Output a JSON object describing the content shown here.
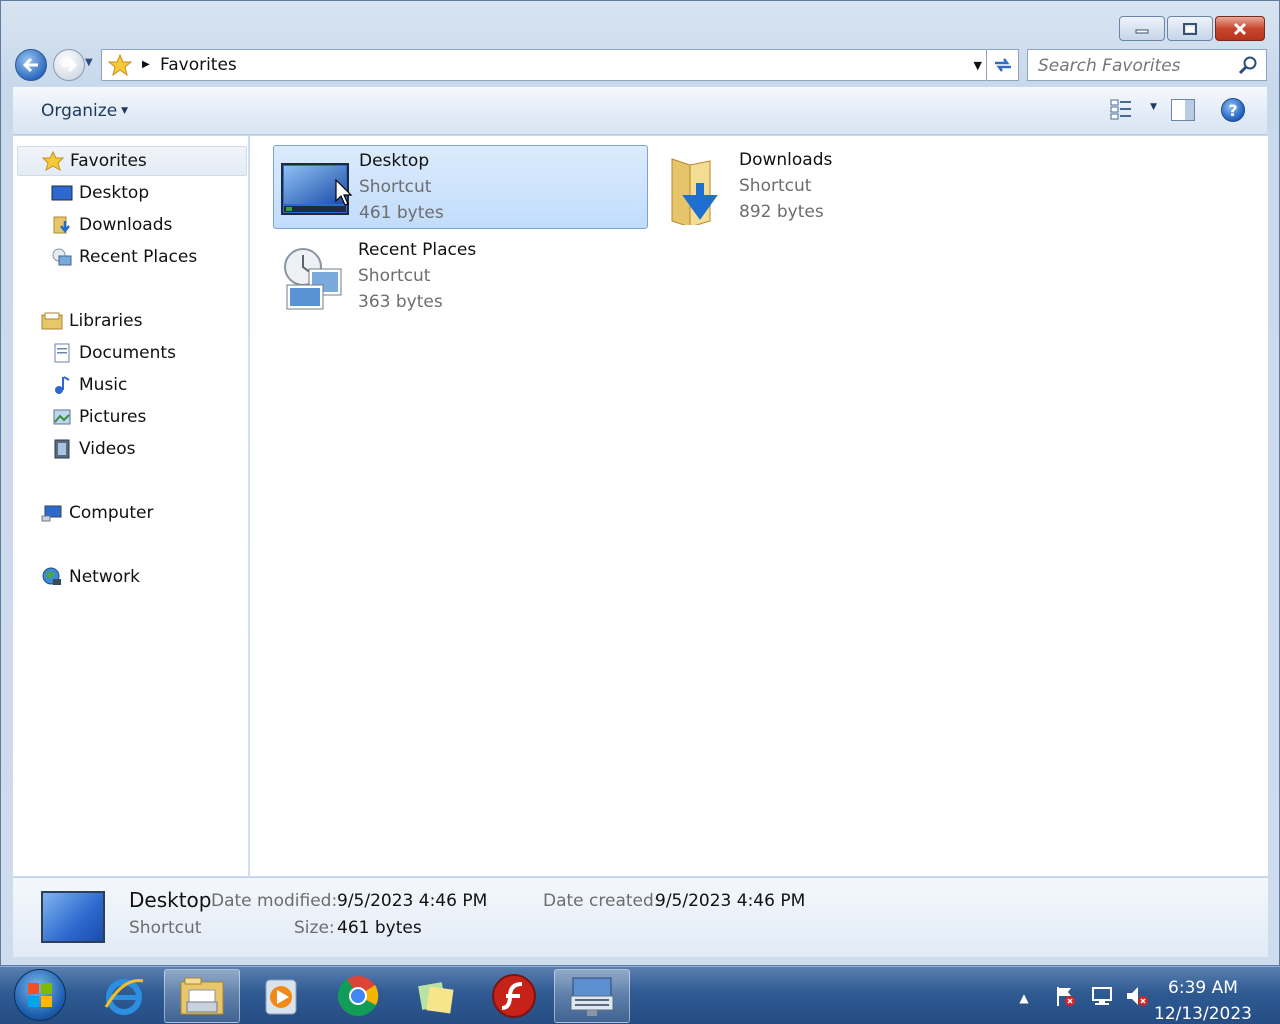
{
  "window": {
    "controls": {
      "minimize": "minimize-icon",
      "maximize": "maximize-icon",
      "close": "close-icon"
    }
  },
  "address_bar": {
    "path": "Favorites",
    "search_placeholder": "Search Favorites"
  },
  "toolbar": {
    "organize_label": "Organize"
  },
  "nav": {
    "favorites": "Favorites",
    "desktop": "Desktop",
    "downloads": "Downloads",
    "recent_places": "Recent Places",
    "libraries": "Libraries",
    "documents": "Documents",
    "music": "Music",
    "pictures": "Pictures",
    "videos": "Videos",
    "computer": "Computer",
    "network": "Network"
  },
  "files": [
    {
      "name": "Desktop",
      "type": "Shortcut",
      "size": "461 bytes"
    },
    {
      "name": "Downloads",
      "type": "Shortcut",
      "size": "892 bytes"
    },
    {
      "name": "Recent Places",
      "type": "Shortcut",
      "size": "363 bytes"
    }
  ],
  "details": {
    "name": "Desktop",
    "type": "Shortcut",
    "modified_label": "Date modified:",
    "modified_value": "9/5/2023 4:46 PM",
    "created_label": "Date created:",
    "created_value": "9/5/2023 4:46 PM",
    "size_label": "Size:",
    "size_value": "461 bytes"
  },
  "taskbar": {
    "time": "6:39 AM",
    "date": "12/13/2023"
  },
  "colors": {
    "accent": "#2d6bc0",
    "selection": "#c1dcfc",
    "taskbar": "#2f5a92"
  }
}
